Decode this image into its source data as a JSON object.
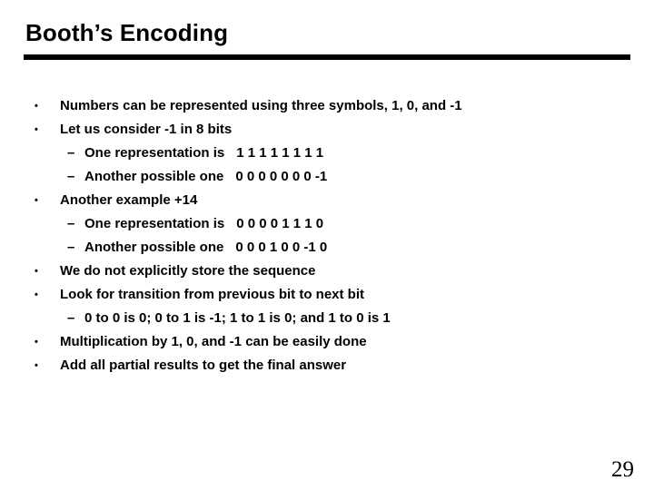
{
  "slide": {
    "title": "Booth’s Encoding",
    "page_number": "29",
    "markers": {
      "level1": "•",
      "level2": "–"
    },
    "bullets": [
      {
        "level": 1,
        "text": "Numbers can be represented using three symbols, 1, 0, and -1"
      },
      {
        "level": 1,
        "text": "Let us consider -1 in 8 bits"
      },
      {
        "level": 2,
        "label": "One representation is",
        "value": "1 1 1 1 1 1 1 1"
      },
      {
        "level": 2,
        "label": "Another possible one",
        "value": "0 0 0 0 0 0 0 -1"
      },
      {
        "level": 1,
        "text": "Another example +14"
      },
      {
        "level": 2,
        "label": "One representation is",
        "value": "0 0 0 0 1 1 1 0"
      },
      {
        "level": 2,
        "label": "Another possible one",
        "value": "0 0 0 1 0 0 -1 0"
      },
      {
        "level": 1,
        "text": "We do not explicitly store the sequence"
      },
      {
        "level": 1,
        "text": "Look for transition from previous bit to next bit"
      },
      {
        "level": 2,
        "text": "0 to 0 is 0; 0 to 1 is -1; 1 to 1 is 0; and 1 to 0 is 1"
      },
      {
        "level": 1,
        "text": "Multiplication by 1, 0, and -1 can be easily done"
      },
      {
        "level": 1,
        "text": "Add all partial results to get the final answer"
      }
    ]
  }
}
